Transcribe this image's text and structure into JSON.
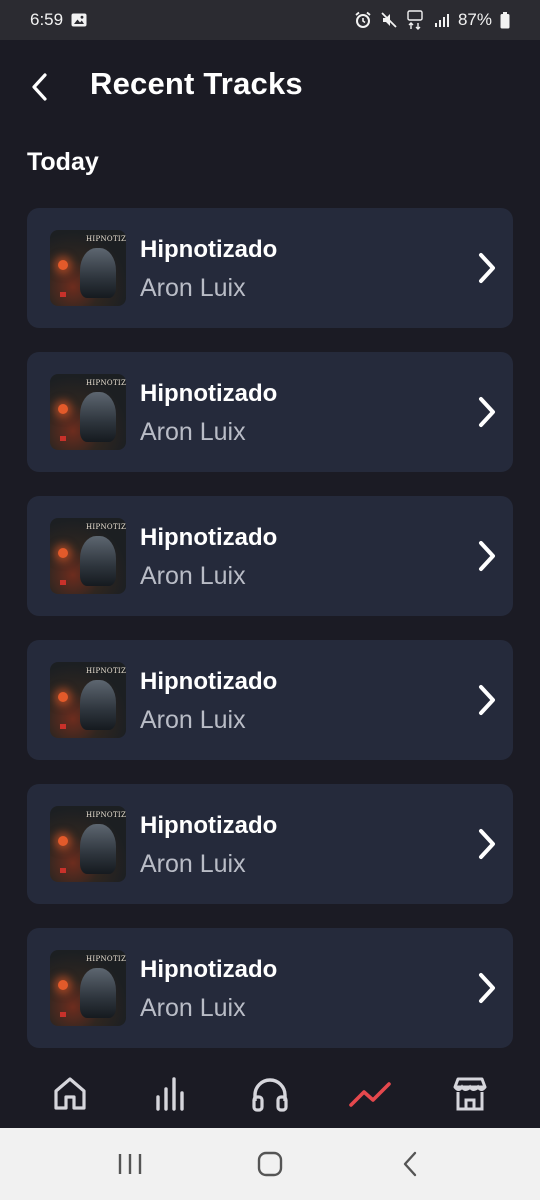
{
  "status_bar": {
    "time": "6:59",
    "battery": "87%"
  },
  "header": {
    "title": "Recent Tracks"
  },
  "section": {
    "label": "Today"
  },
  "tracks": [
    {
      "title": "Hipnotizado",
      "artist": "Aron Luix"
    },
    {
      "title": "Hipnotizado",
      "artist": "Aron Luix"
    },
    {
      "title": "Hipnotizado",
      "artist": "Aron Luix"
    },
    {
      "title": "Hipnotizado",
      "artist": "Aron Luix"
    },
    {
      "title": "Hipnotizado",
      "artist": "Aron Luix"
    },
    {
      "title": "Hipnotizado",
      "artist": "Aron Luix"
    }
  ],
  "cover_art_text": "HIPNOTIZADO",
  "bottom_nav": {
    "items": [
      {
        "icon": "home-icon",
        "active": false
      },
      {
        "icon": "stats-icon",
        "active": false
      },
      {
        "icon": "headphones-icon",
        "active": false
      },
      {
        "icon": "trend-icon",
        "active": true
      },
      {
        "icon": "store-icon",
        "active": false
      }
    ],
    "active_color": "#e5484d",
    "inactive_color": "#d6d6dc"
  },
  "system_nav": {
    "items": [
      "recents-icon",
      "home-circle-icon",
      "back-icon"
    ]
  }
}
